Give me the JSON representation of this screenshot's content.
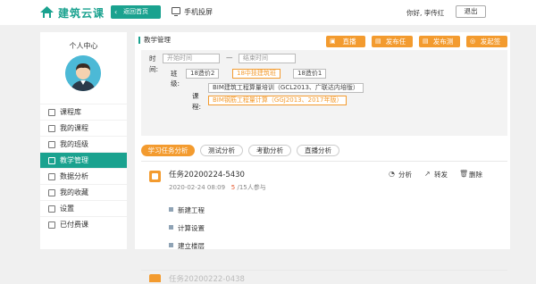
{
  "header": {
    "logo_text": "建筑云课",
    "home_label": "返回首页",
    "screen_label": "手机投屏",
    "greeting": "你好, 李传红",
    "logout_label": "退出"
  },
  "sidebar": {
    "title": "个人中心",
    "items": [
      {
        "label": "课程库",
        "icon": "box-icon"
      },
      {
        "label": "我的课程",
        "icon": "book-icon"
      },
      {
        "label": "我的班级",
        "icon": "class-icon"
      },
      {
        "label": "教学管理",
        "icon": "manage-icon",
        "active": true
      },
      {
        "label": "数据分析",
        "icon": "chart-icon"
      },
      {
        "label": "我的收藏",
        "icon": "star-icon"
      },
      {
        "label": "设置",
        "icon": "gear-icon"
      },
      {
        "label": "已付费课",
        "icon": "paid-icon"
      }
    ]
  },
  "main": {
    "section_title": "教学管理",
    "buttons": {
      "live": "直播",
      "publish_task": "发布任",
      "publish_test": "发布测",
      "publish_sign": "发起签"
    },
    "filter": {
      "time_label": "时\n间:",
      "start_placeholder": "开始时间",
      "end_placeholder": "结束时间",
      "dash": "—",
      "class_label": "班\n级:",
      "classes": [
        "18造价2",
        "18中技建筑班",
        "18造价1"
      ],
      "course_label": "课\n程:",
      "courses": [
        "BIM建筑工程算量培训（GCL2013、广联达内培版）",
        "BIM钢筋工程量计算（GGJ2013、2017年版）"
      ]
    },
    "tabs": [
      "学习任务分析",
      "测试分析",
      "考勤分析",
      "直播分析"
    ],
    "task": {
      "title": "任务20200224-5430",
      "datetime": "2020-02-24 08:09",
      "participants_num": "5",
      "participants_text": "/15人参与",
      "actions": {
        "analyze": "分析",
        "forward": "转发",
        "delete": "删除"
      },
      "steps": [
        "新建工程",
        "计算设置",
        "建立楼层"
      ]
    },
    "next_task_title": "任务20200222-0438"
  },
  "colors": {
    "brand": "#1aa28f",
    "accent": "#f39b2f",
    "highlight": "#e4572e"
  }
}
